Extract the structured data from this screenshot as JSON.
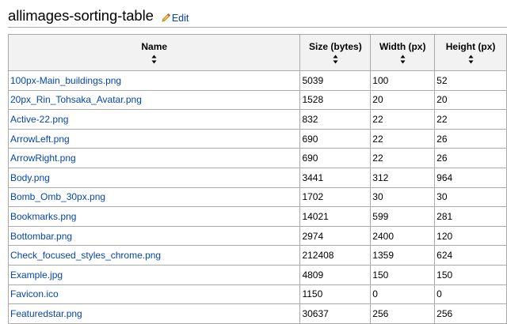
{
  "page": {
    "title": "allimages-sorting-table",
    "edit_label": "Edit"
  },
  "table": {
    "headers": [
      "Name",
      "Size (bytes)",
      "Width (px)",
      "Height (px)"
    ],
    "rows": [
      {
        "name": "100px-Main_buildings.png",
        "size": "5039",
        "width": "100",
        "height": "52"
      },
      {
        "name": "20px_Rin_Tohsaka_Avatar.png",
        "size": "1528",
        "width": "20",
        "height": "20"
      },
      {
        "name": "Active-22.png",
        "size": "832",
        "width": "22",
        "height": "22"
      },
      {
        "name": "ArrowLeft.png",
        "size": "690",
        "width": "22",
        "height": "26"
      },
      {
        "name": "ArrowRight.png",
        "size": "690",
        "width": "22",
        "height": "26"
      },
      {
        "name": "Body.png",
        "size": "3441",
        "width": "312",
        "height": "964"
      },
      {
        "name": "Bomb_Omb_30px.png",
        "size": "1702",
        "width": "30",
        "height": "30"
      },
      {
        "name": "Bookmarks.png",
        "size": "14021",
        "width": "599",
        "height": "281"
      },
      {
        "name": "Bottombar.png",
        "size": "2974",
        "width": "2400",
        "height": "120"
      },
      {
        "name": "Check_focused_styles_chrome.png",
        "size": "212408",
        "width": "1359",
        "height": "624"
      },
      {
        "name": "Example.jpg",
        "size": "4809",
        "width": "150",
        "height": "150"
      },
      {
        "name": "Favicon.ico",
        "size": "1150",
        "width": "0",
        "height": "0"
      },
      {
        "name": "Featuredstar.png",
        "size": "30637",
        "width": "256",
        "height": "256"
      }
    ]
  },
  "icons": {
    "edit": "pencil-icon",
    "sort": "sort-arrows-icon"
  },
  "colors": {
    "link": "#0645ad",
    "header_bg": "#f2f2f2",
    "border": "#aaaaaa"
  }
}
